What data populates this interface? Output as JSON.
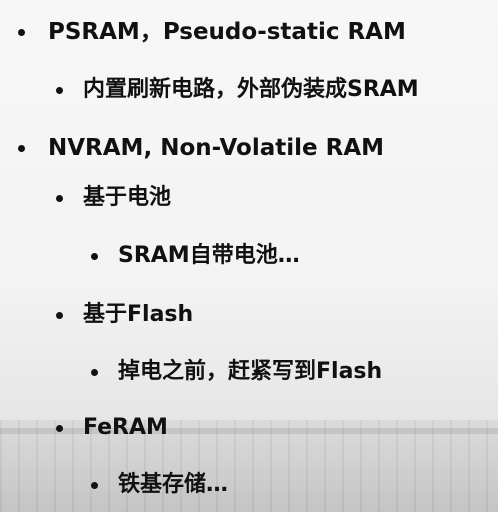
{
  "slide": {
    "bullets": [
      {
        "level": 1,
        "text": "PSRAM，Pseudo-static RAM"
      },
      {
        "level": 2,
        "text": "内置刷新电路，外部伪装成SRAM"
      },
      {
        "level": 1,
        "text": "NVRAM, Non-Volatile RAM"
      },
      {
        "level": 2,
        "text": "基于电池"
      },
      {
        "level": 3,
        "text": "SRAM自带电池…"
      },
      {
        "level": 2,
        "text": "基于Flash"
      },
      {
        "level": 3,
        "text": "掉电之前，赶紧写到Flash"
      },
      {
        "level": 2,
        "text": "FeRAM"
      },
      {
        "level": 3,
        "text": "铁基存储…"
      }
    ]
  }
}
